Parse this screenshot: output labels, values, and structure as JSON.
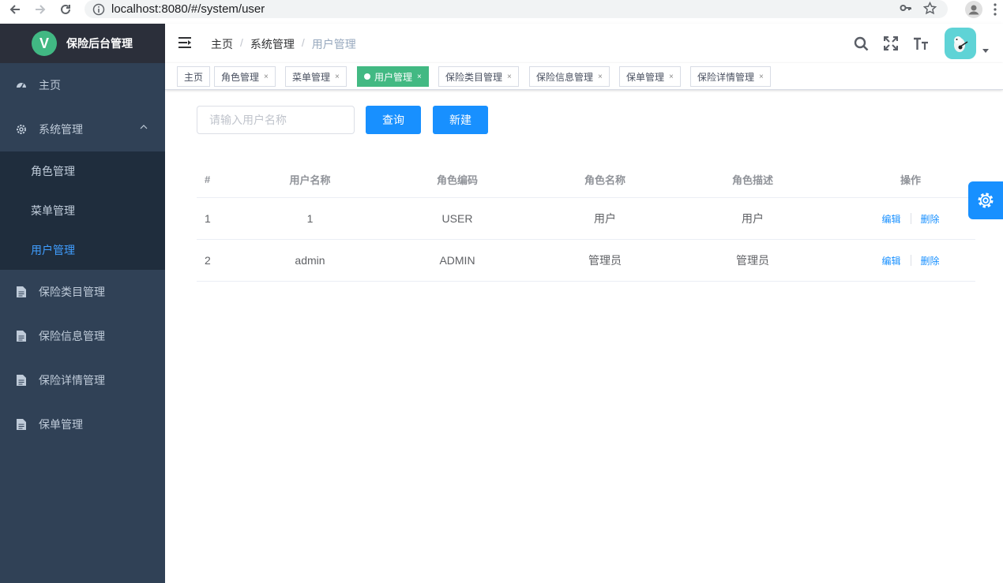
{
  "browser": {
    "url": "localhost:8080/#/system/user"
  },
  "app": {
    "logo_letter": "V",
    "title": "保险后台管理"
  },
  "sidebar": {
    "items": [
      {
        "label": "主页",
        "icon": "dashboard-icon"
      },
      {
        "label": "系统管理",
        "icon": "gear-icon"
      },
      {
        "label": "保险类目管理",
        "icon": "document-icon"
      },
      {
        "label": "保险信息管理",
        "icon": "document-icon"
      },
      {
        "label": "保险详情管理",
        "icon": "document-icon"
      },
      {
        "label": "保单管理",
        "icon": "document-icon"
      }
    ],
    "submenu": [
      {
        "label": "角色管理"
      },
      {
        "label": "菜单管理"
      },
      {
        "label": "用户管理"
      }
    ]
  },
  "breadcrumb": {
    "items": [
      "主页",
      "系统管理",
      "用户管理"
    ]
  },
  "tags": [
    {
      "label": "主页"
    },
    {
      "label": "角色管理"
    },
    {
      "label": "菜单管理"
    },
    {
      "label": "用户管理"
    },
    {
      "label": "保险类目管理"
    },
    {
      "label": "保险信息管理"
    },
    {
      "label": "保单管理"
    },
    {
      "label": "保险详情管理"
    }
  ],
  "search": {
    "placeholder": "请输入用户名称",
    "query_label": "查询",
    "new_label": "新建"
  },
  "table": {
    "headers": [
      "#",
      "用户名称",
      "角色编码",
      "角色名称",
      "角色描述",
      "操作"
    ],
    "rows": [
      {
        "index": "1",
        "username": "1",
        "role_code": "USER",
        "role_name": "用户",
        "role_desc": "用户",
        "edit": "编辑",
        "delete": "删除"
      },
      {
        "index": "2",
        "username": "admin",
        "role_code": "ADMIN",
        "role_name": "管理员",
        "role_desc": "管理员",
        "edit": "编辑",
        "delete": "删除"
      }
    ]
  },
  "colors": {
    "sidebar_bg": "#304156",
    "primary": "#1890ff",
    "active_tag": "#42b983"
  }
}
